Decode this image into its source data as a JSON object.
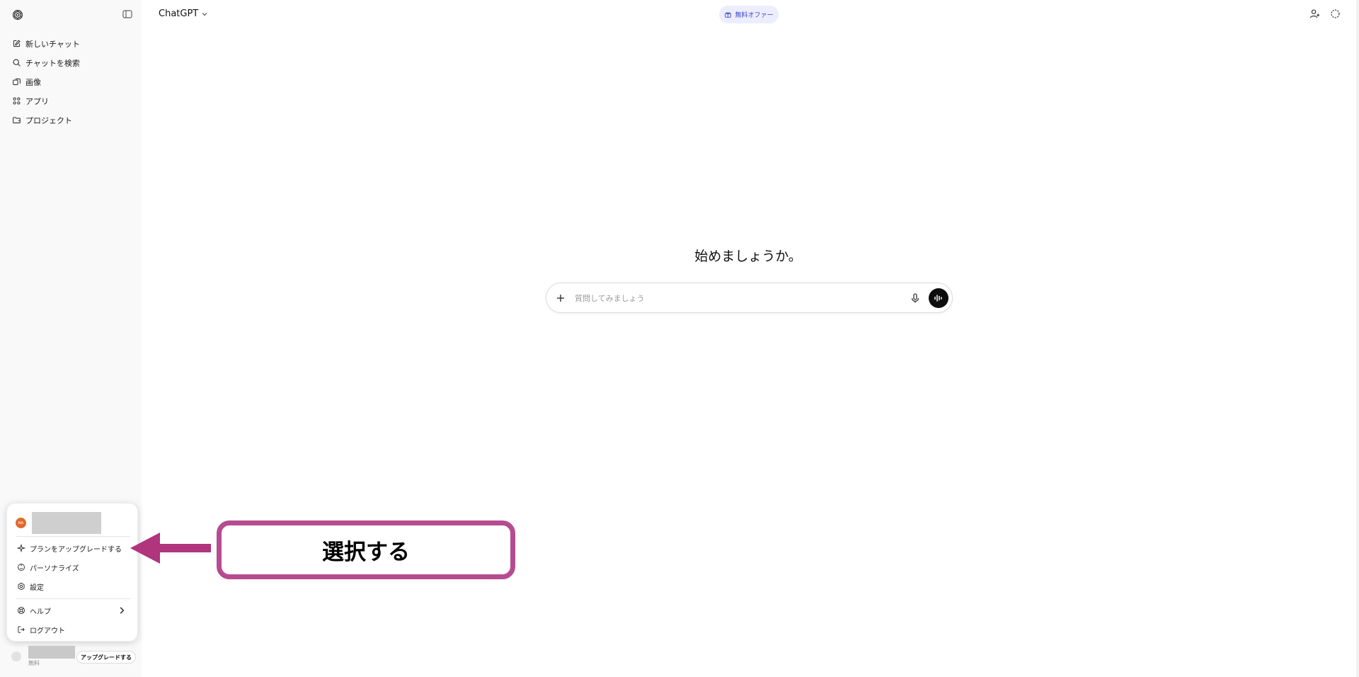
{
  "header": {
    "model": "ChatGPT",
    "offer": "無料オファー"
  },
  "sidebar": {
    "items": [
      {
        "label": "新しいチャット",
        "icon": "edit-icon"
      },
      {
        "label": "チャットを検索",
        "icon": "search-icon"
      },
      {
        "label": "画像",
        "icon": "images-icon"
      },
      {
        "label": "アプリ",
        "icon": "apps-icon"
      },
      {
        "label": "プロジェクト",
        "icon": "folder-icon"
      }
    ]
  },
  "account_menu": {
    "avatar_initials": "NA",
    "items": [
      {
        "label": "プランをアップグレードする",
        "icon": "sparkle-icon"
      },
      {
        "label": "パーソナライズ",
        "icon": "personalize-icon"
      },
      {
        "label": "設定",
        "icon": "gear-icon"
      },
      {
        "label": "ヘルプ",
        "icon": "help-icon"
      },
      {
        "label": "ログアウト",
        "icon": "logout-icon"
      }
    ]
  },
  "user": {
    "plan": "無料",
    "upgrade_label": "アップグレードする"
  },
  "main": {
    "greeting": "始めましょうか。",
    "composer_placeholder": "質問してみましょう"
  },
  "annotation": {
    "text": "選択する",
    "color": "#b64c8f"
  }
}
